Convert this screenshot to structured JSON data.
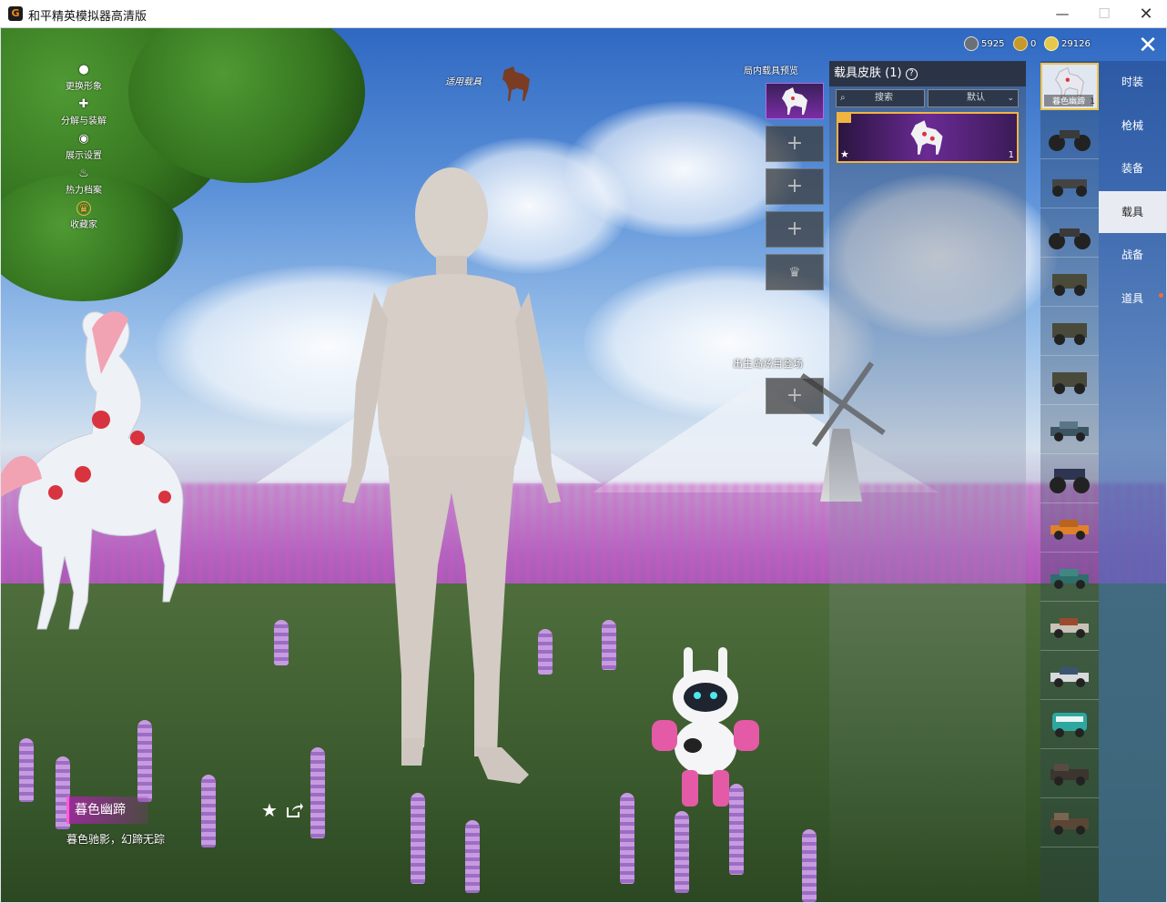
{
  "window": {
    "title": "和平精英模拟器高清版",
    "minimize": "—",
    "maximize": "☐",
    "close": "✕"
  },
  "left_menu": [
    {
      "label": "更换形象",
      "icon": "person-icon"
    },
    {
      "label": "分解与装解",
      "icon": "puzzle-icon"
    },
    {
      "label": "展示设置",
      "icon": "eye-icon"
    },
    {
      "label": "热力档案",
      "icon": "flame-icon"
    },
    {
      "label": "收藏家",
      "icon": "collector-badge-icon"
    }
  ],
  "apply_vehicle_label": "适用载具",
  "currency": [
    {
      "value": "5925",
      "icon": "silver-coin-icon",
      "color": "#6b6f78"
    },
    {
      "value": "0",
      "icon": "gold-token-icon",
      "color": "#c59a2a"
    },
    {
      "value": "29126",
      "icon": "crystal-coin-icon",
      "color": "#e6c84a"
    }
  ],
  "slots_title": "局内载具预览",
  "spawn_title": "出生岛炫目登场",
  "skin_panel": {
    "title": "载具皮肤 (1)",
    "help_glyph": "?",
    "search_label": "搜索",
    "sort_label": "默认",
    "card_count": "1"
  },
  "vehicle_list": {
    "selected_label": "暮色幽蹄",
    "selected_count": "1"
  },
  "tabs": [
    {
      "label": "时装",
      "active": false
    },
    {
      "label": "枪械",
      "active": false
    },
    {
      "label": "装备",
      "active": false
    },
    {
      "label": "载具",
      "active": true
    },
    {
      "label": "战备",
      "active": false
    },
    {
      "label": "道具",
      "active": false
    }
  ],
  "item_name": "暮色幽蹄",
  "item_desc": "暮色驰影，幻蹄无踪",
  "colors": {
    "accent_orange": "#f2b441",
    "tab_active_bg": "#e8ecf2",
    "tab_bar": "#3c6fb3",
    "name_tag": "#a028a0"
  }
}
